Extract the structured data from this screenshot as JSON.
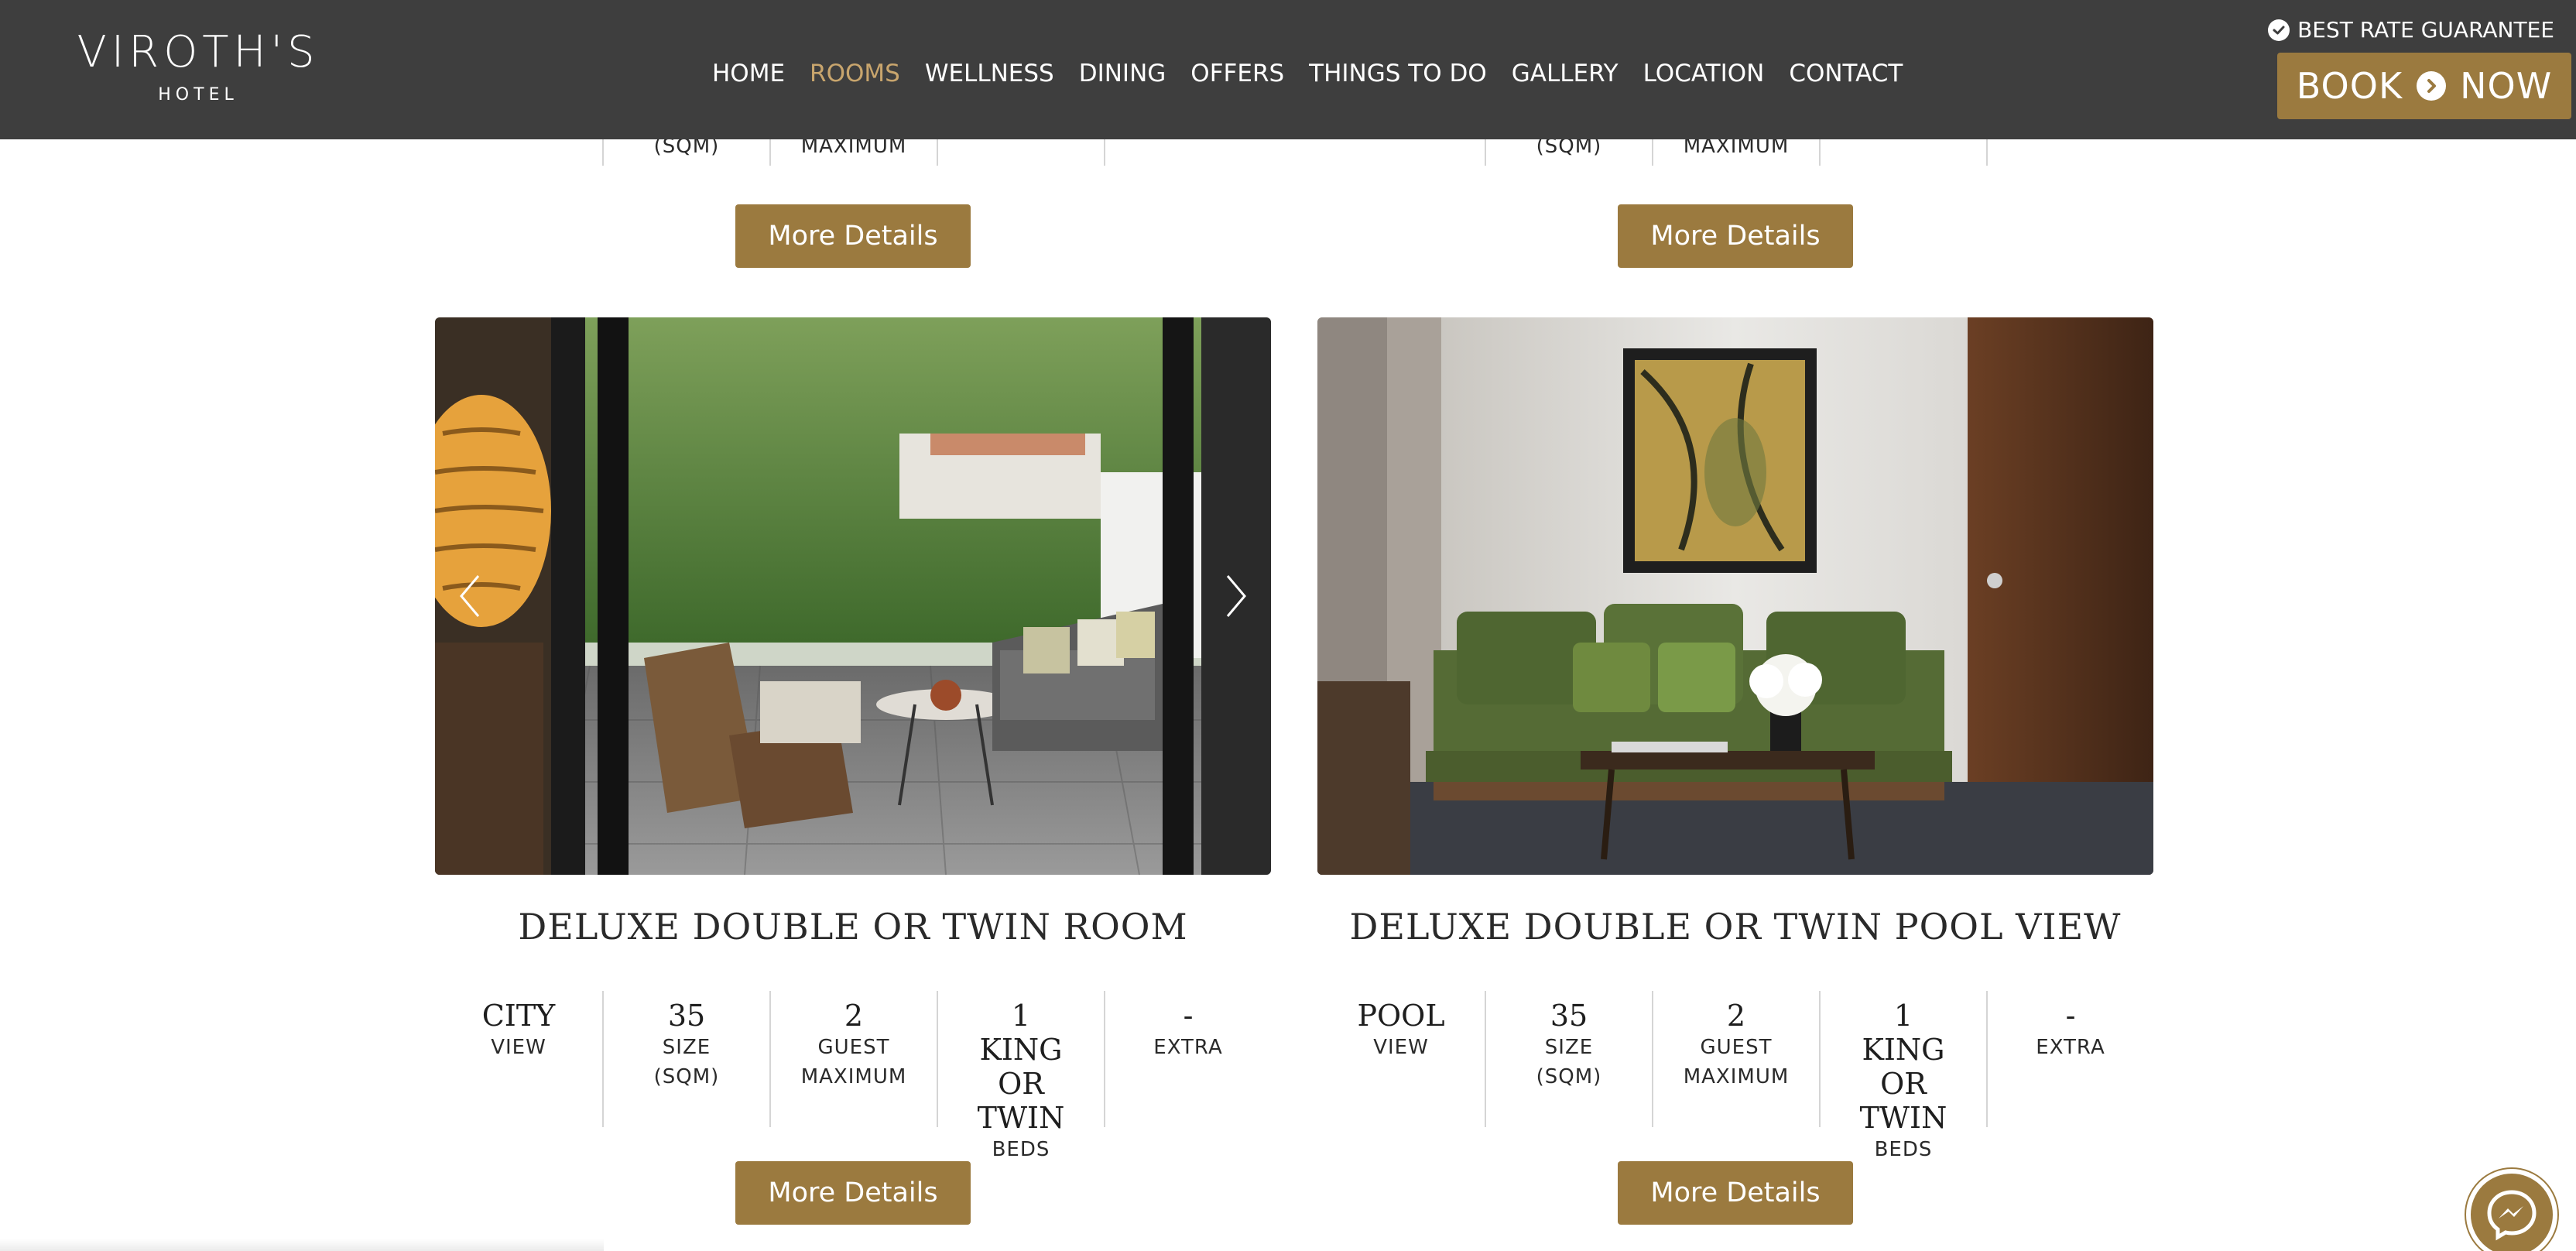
{
  "header": {
    "logo_main": "VIROTH'S",
    "logo_sub": "HOTEL",
    "nav": [
      {
        "label": "HOME",
        "active": false
      },
      {
        "label": "ROOMS",
        "active": true
      },
      {
        "label": "WELLNESS",
        "active": false
      },
      {
        "label": "DINING",
        "active": false
      },
      {
        "label": "OFFERS",
        "active": false
      },
      {
        "label": "THINGS TO DO",
        "active": false
      },
      {
        "label": "GALLERY",
        "active": false
      },
      {
        "label": "LOCATION",
        "active": false
      },
      {
        "label": "CONTACT",
        "active": false
      }
    ],
    "best_rate": "BEST RATE GUARANTEE",
    "book_left": "BOOK",
    "book_right": "NOW"
  },
  "colors": {
    "header_bg": "#3e3e3e",
    "accent": "#9b7a3f",
    "active_nav": "#c8a56d"
  },
  "top_cards": [
    {
      "specs": [
        {
          "value": "",
          "label": ""
        },
        {
          "value": "",
          "label": "(SQM)"
        },
        {
          "value": "",
          "label": "MAXIMUM"
        },
        {
          "value": "",
          "label": ""
        },
        {
          "value": "",
          "label": ""
        }
      ],
      "button": "More Details"
    },
    {
      "specs": [
        {
          "value": "",
          "label": ""
        },
        {
          "value": "",
          "label": "(SQM)"
        },
        {
          "value": "",
          "label": "MAXIMUM"
        },
        {
          "value": "",
          "label": ""
        },
        {
          "value": "",
          "label": ""
        }
      ],
      "button": "More Details"
    }
  ],
  "rooms": [
    {
      "title": "DELUXE DOUBLE OR TWIN ROOM",
      "specs": [
        {
          "value": "CITY",
          "label": "VIEW"
        },
        {
          "value": "35",
          "label": "SIZE (SQM)"
        },
        {
          "value": "2",
          "label": "GUEST MAXIMUM"
        },
        {
          "value": "1 KING OR TWIN",
          "label": "BEDS"
        },
        {
          "value": "-",
          "label": "EXTRA"
        }
      ],
      "button": "More Details",
      "image_icon": "balcony-photo"
    },
    {
      "title": "DELUXE DOUBLE OR TWIN POOL VIEW",
      "specs": [
        {
          "value": "POOL",
          "label": "VIEW"
        },
        {
          "value": "35",
          "label": "SIZE (SQM)"
        },
        {
          "value": "2",
          "label": "GUEST MAXIMUM"
        },
        {
          "value": "1 KING OR TWIN",
          "label": "BEDS"
        },
        {
          "value": "-",
          "label": "EXTRA"
        }
      ],
      "button": "More Details",
      "image_icon": "living-room-photo"
    }
  ],
  "messenger_icon": "messenger-icon"
}
